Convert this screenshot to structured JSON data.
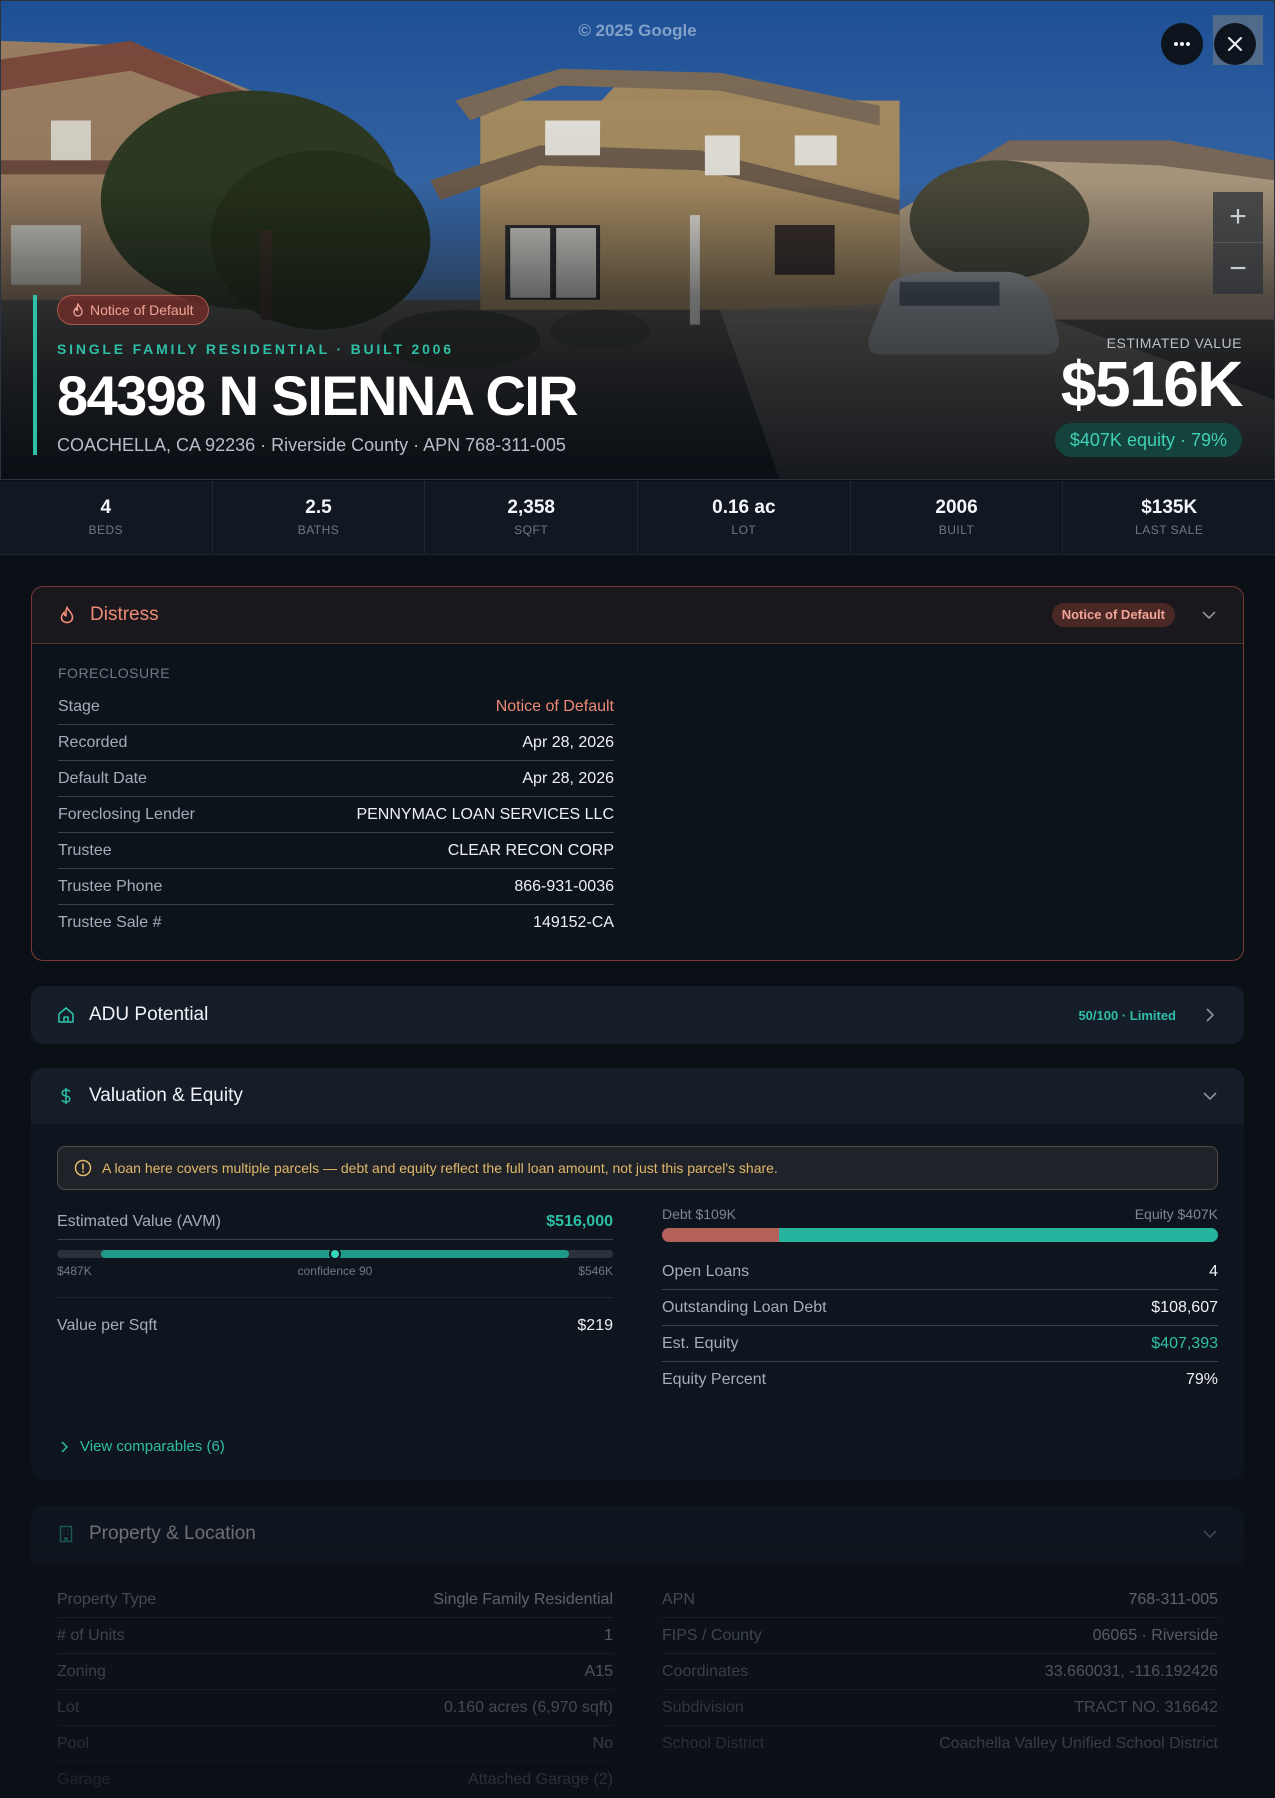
{
  "hero": {
    "watermark": "© 2025 Google",
    "badge": "Notice of Default",
    "eyebrow": "SINGLE FAMILY RESIDENTIAL · BUILT 2006",
    "address": "84398 N SIENNA CIR",
    "subaddress": "COACHELLA, CA 92236 · Riverside County · APN 768-311-005",
    "estimated_value_label": "ESTIMATED VALUE",
    "estimated_value": "$516K",
    "equity_pill": "$407K equity · 79%",
    "buttons": {
      "more": "more-icon",
      "close": "close-icon",
      "zoom_in": "+",
      "zoom_out": "−"
    }
  },
  "stats": [
    {
      "value": "4",
      "label": "BEDS"
    },
    {
      "value": "2.5",
      "label": "BATHS"
    },
    {
      "value": "2,358",
      "label": "SQFT"
    },
    {
      "value": "0.16 ac",
      "label": "LOT"
    },
    {
      "value": "2006",
      "label": "BUILT"
    },
    {
      "value": "$135K",
      "label": "LAST SALE"
    }
  ],
  "distress": {
    "title": "Distress",
    "badge": "Notice of Default",
    "section": "FORECLOSURE",
    "rows": [
      {
        "k": "Stage",
        "v": "Notice of Default"
      },
      {
        "k": "Recorded",
        "v": "Apr 28, 2026"
      },
      {
        "k": "Default Date",
        "v": "Apr 28, 2026"
      },
      {
        "k": "Foreclosing Lender",
        "v": "PENNYMAC LOAN SERVICES LLC"
      },
      {
        "k": "Trustee",
        "v": "CLEAR RECON CORP"
      },
      {
        "k": "Trustee Phone",
        "v": "866-931-0036"
      },
      {
        "k": "Trustee Sale #",
        "v": "149152-CA"
      }
    ]
  },
  "adu": {
    "title": "ADU Potential",
    "score": "50/100 · Limited"
  },
  "valuation": {
    "title": "Valuation & Equity",
    "notice": "A loan here covers multiple parcels — debt and equity reflect the full loan amount, not just this parcel's share.",
    "avm_label": "Estimated Value (AVM)",
    "avm_value": "$516,000",
    "avm_low": "$487K",
    "avm_high": "$546K",
    "avm_confidence": "confidence 90",
    "avm_range_start_pct": 8,
    "avm_range_end_pct": 92,
    "avm_point_pct": 50,
    "value_per_sqft_label": "Value per Sqft",
    "value_per_sqft": "$219",
    "debt_label": "Debt $109K",
    "equity_label": "Equity $407K",
    "debt_share": 0.21,
    "right_rows": [
      {
        "k": "Open Loans",
        "v": "4"
      },
      {
        "k": "Outstanding Loan Debt",
        "v": "$108,607"
      },
      {
        "k": "Est. Equity",
        "v": "$407,393"
      },
      {
        "k": "Equity Percent",
        "v": "79%"
      }
    ],
    "comparables_link": "View comparables (6)"
  },
  "property": {
    "title": "Property & Location",
    "left_rows": [
      {
        "k": "Property Type",
        "v": "Single Family Residential"
      },
      {
        "k": "# of Units",
        "v": "1"
      },
      {
        "k": "Zoning",
        "v": "A15"
      },
      {
        "k": "Lot",
        "v": "0.160 acres (6,970 sqft)"
      },
      {
        "k": "Pool",
        "v": "No"
      },
      {
        "k": "Garage",
        "v": "Attached Garage (2)"
      }
    ],
    "right_rows": [
      {
        "k": "APN",
        "v": "768-311-005"
      },
      {
        "k": "FIPS / County",
        "v": "06065 · Riverside"
      },
      {
        "k": "Coordinates",
        "v": "33.660031, -116.192426"
      },
      {
        "k": "Subdivision",
        "v": "TRACT NO. 31664​2"
      },
      {
        "k": "School District",
        "v": "Coachella Valley Unified School District"
      }
    ]
  },
  "colors": {
    "accent": "#2fbfa7",
    "distress": "#ef8a76",
    "debt": "#b4615a",
    "equity": "#26b49f",
    "warning": "#e0b86a"
  }
}
